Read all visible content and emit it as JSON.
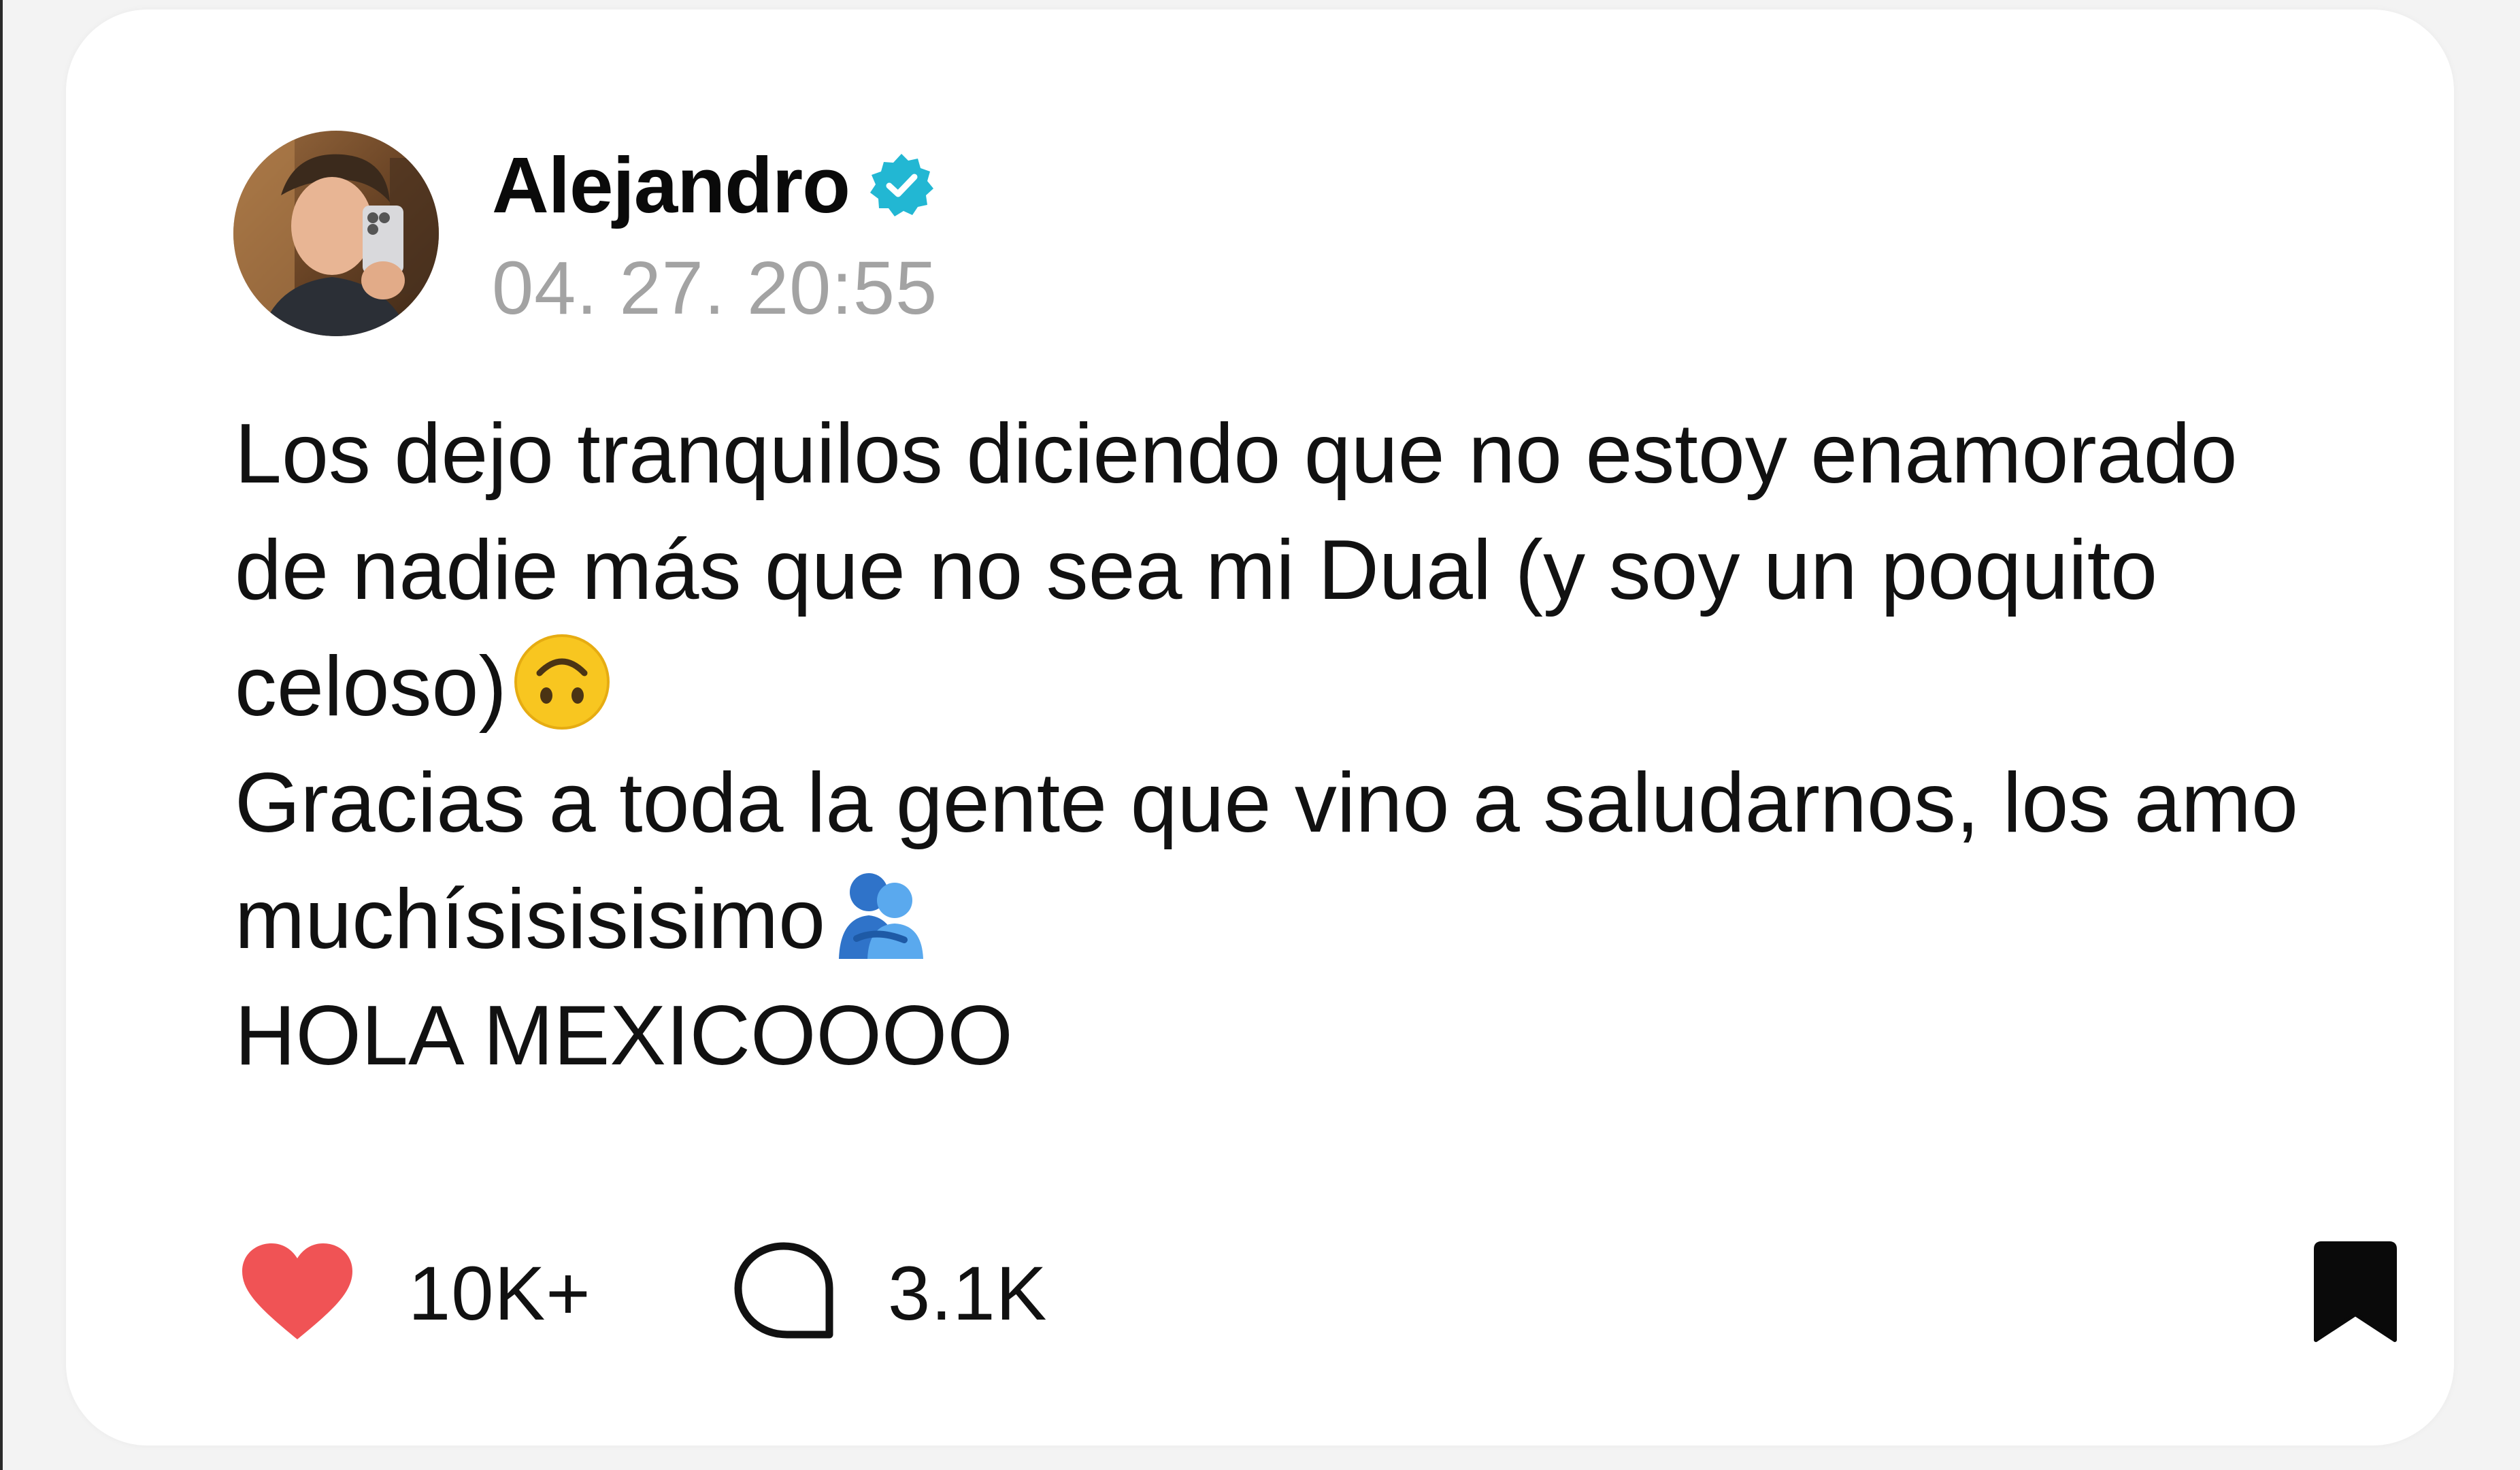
{
  "post": {
    "author": {
      "name": "Alejandro",
      "verified": true
    },
    "timestamp": "04. 27. 20:55",
    "body_lines": [
      "Los dejo tranquilos diciendo que no estoy enamorado",
      "de nadie más que no sea mi Dual (y soy un poquito",
      "celoso)",
      "Gracias a toda la gente que vino a saludarnos, los amo",
      "muchísisisisimo",
      "HOLA MEXICOOOO"
    ],
    "emojis": {
      "line3": "upside-down-face-icon",
      "line5": "people-hugging-icon"
    }
  },
  "actions": {
    "like_count": "10K+",
    "comment_count": "3.1K"
  },
  "icons": {
    "like": "heart-icon",
    "comment": "comment-bubble-icon",
    "bookmark": "bookmark-icon",
    "verified": "verified-badge-icon"
  },
  "colors": {
    "background": "#ffffff",
    "heart": "#f05355",
    "verified_badge": "#22b7d3",
    "timestamp": "#a3a3a3",
    "text": "#111111"
  }
}
